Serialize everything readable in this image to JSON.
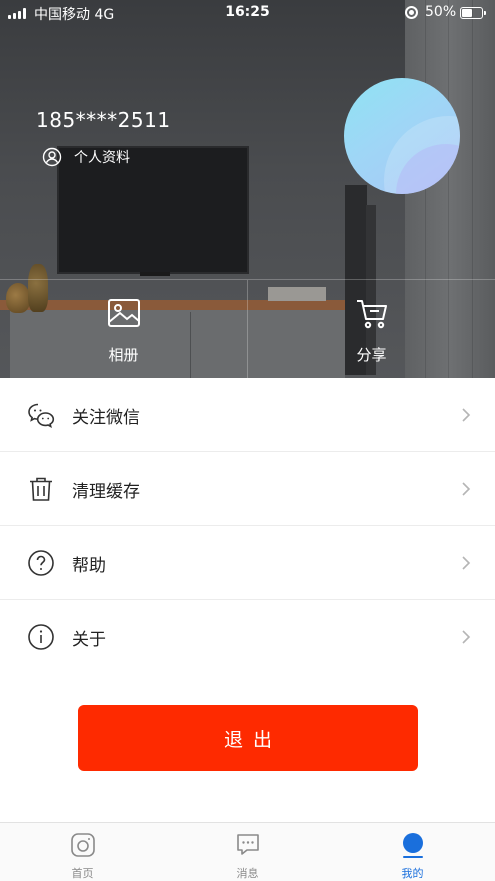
{
  "status_bar": {
    "carrier": "中国移动  4G",
    "time": "16:25",
    "battery": "50%"
  },
  "profile": {
    "phone": "185****2511",
    "profile_link": "个人资料"
  },
  "quick_actions": [
    {
      "label": "相册",
      "icon": "photo-album-icon"
    },
    {
      "label": "分享",
      "icon": "cart-icon"
    }
  ],
  "menu": [
    {
      "label": "关注微信",
      "icon": "wechat-icon"
    },
    {
      "label": "清理缓存",
      "icon": "trash-icon"
    },
    {
      "label": "帮助",
      "icon": "help-icon"
    },
    {
      "label": "关于",
      "icon": "info-icon"
    }
  ],
  "logout_label": "退出",
  "tabs": [
    {
      "label": "首页",
      "icon": "home-icon",
      "active": false
    },
    {
      "label": "消息",
      "icon": "message-icon",
      "active": false
    },
    {
      "label": "我的",
      "icon": "profile-icon",
      "active": true
    }
  ],
  "colors": {
    "accent": "#fe2a00",
    "tab_active": "#1a6fdc"
  }
}
